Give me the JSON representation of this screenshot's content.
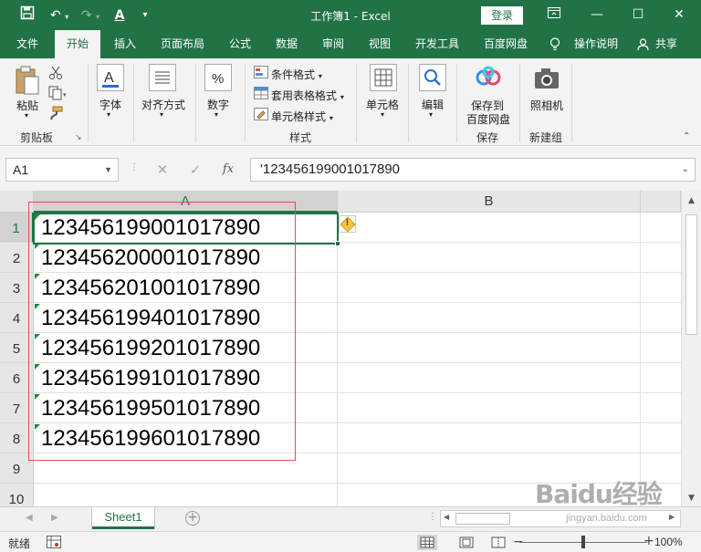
{
  "titlebar": {
    "title": "工作簿1  -  Excel",
    "login": "登录"
  },
  "tabs": [
    "文件",
    "开始",
    "插入",
    "页面布局",
    "公式",
    "数据",
    "审阅",
    "视图",
    "开发工具",
    "百度网盘",
    "操作说明",
    "共享"
  ],
  "ribbon": {
    "paste": "粘贴",
    "clipboard": "剪贴板",
    "font": "字体",
    "align": "对齐方式",
    "number": "数字",
    "cond_format": "条件格式",
    "table_format": "套用表格格式",
    "cell_style": "单元格样式",
    "styles": "样式",
    "cells": "单元格",
    "edit": "编辑",
    "save_baidu_1": "保存到",
    "save_baidu_2": "百度网盘",
    "save": "保存",
    "camera": "照相机",
    "new_group": "新建组"
  },
  "formula_bar": {
    "name_box": "A1",
    "formula": "'123456199001017890",
    "fx": "fx"
  },
  "columns": [
    "A",
    "B"
  ],
  "rows": [
    {
      "num": "1",
      "value": "123456199001017890"
    },
    {
      "num": "2",
      "value": "123456200001017890"
    },
    {
      "num": "3",
      "value": "123456201001017890"
    },
    {
      "num": "4",
      "value": "123456199401017890"
    },
    {
      "num": "5",
      "value": "123456199201017890"
    },
    {
      "num": "6",
      "value": "123456199101017890"
    },
    {
      "num": "7",
      "value": "123456199501017890"
    },
    {
      "num": "8",
      "value": "123456199601017890"
    },
    {
      "num": "9",
      "value": ""
    },
    {
      "num": "10",
      "value": ""
    }
  ],
  "sheet_tab": "Sheet1",
  "status": {
    "ready": "就绪",
    "zoom": "100%"
  },
  "watermark": {
    "logo": "Baidu经验",
    "url": "jingyan.baidu.com"
  }
}
